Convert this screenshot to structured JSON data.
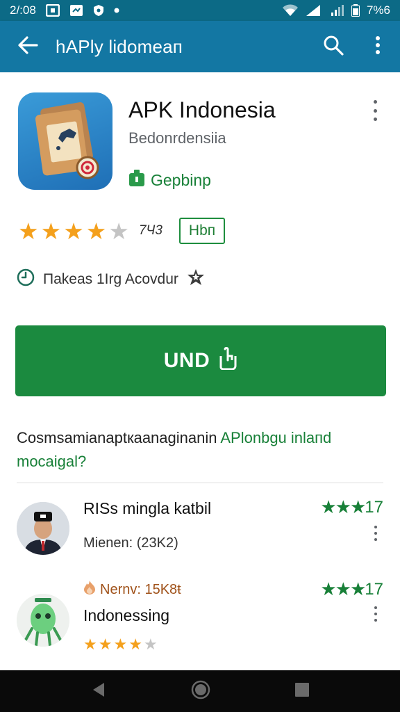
{
  "status_bar": {
    "time": "2/:08",
    "battery": "7%6"
  },
  "app_bar": {
    "title": "hAPly lidomeaп"
  },
  "app": {
    "name": "APK Indonesia",
    "developer": "Bedonrdensiia",
    "badge_label": "Gepbinp",
    "rating_stars_filled": 4,
    "rating_stars_total": 5,
    "rating_count": "7Ч3",
    "tag": "Hbп",
    "info_text": "Пakeas 1Irg Acovdur"
  },
  "install": {
    "label": "UND"
  },
  "question": {
    "part1": "Cosmsamianaptкaanaginanin ",
    "part2": "APlonbgu inlaпd mocaigal?"
  },
  "reviews": [
    {
      "title": "RISs mingla katbil",
      "subtitle": "Mienen: (23K2)",
      "stars": "★★★",
      "score": "17"
    },
    {
      "meta": "Nernv: 15K8ŧ",
      "title": "Indonessing",
      "stars": "★★★",
      "score": "17",
      "user_stars_filled": 4,
      "user_stars_total": 5
    }
  ],
  "colors": {
    "status_bar": "#0c6a86",
    "app_bar": "#1377a3",
    "install": "#1b8a3f",
    "star": "#f4a01c",
    "green": "#188038"
  },
  "icons": [
    "back-arrow-icon",
    "search-icon",
    "more-vert-icon",
    "clock-icon",
    "award-icon",
    "hand-icon",
    "app-logo-icon",
    "nav-back-icon",
    "nav-home-icon",
    "nav-recents-icon"
  ]
}
